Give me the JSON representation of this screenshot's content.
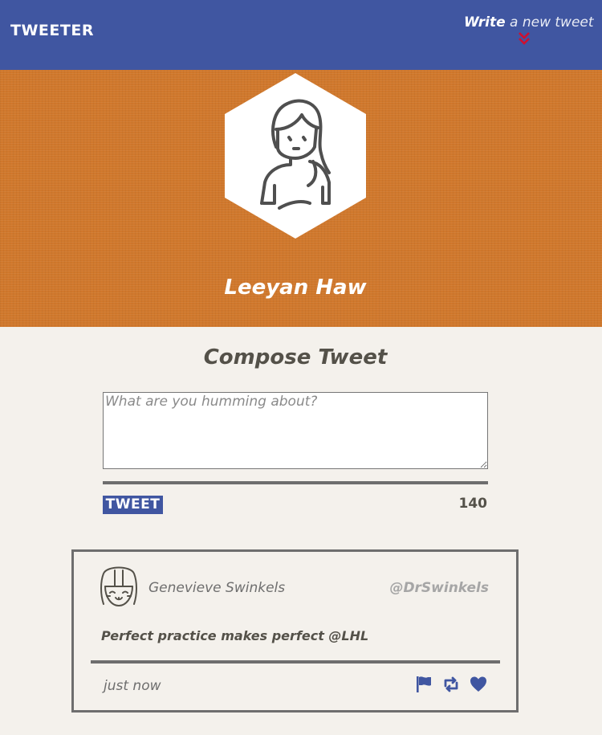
{
  "nav": {
    "brand": "TWEETER",
    "compose_toggle": {
      "strong": "Write",
      "rest": "a new tweet",
      "icon": "double-chevron-down-icon"
    }
  },
  "profile": {
    "name": "Leeyan Haw",
    "avatar_icon": "user-avatar-icon"
  },
  "compose": {
    "title": "Compose Tweet",
    "placeholder": "What are you humming about?",
    "value": "",
    "submit_label": "TWEET",
    "counter": "140"
  },
  "tweets": [
    {
      "author": "Genevieve Swinkels",
      "handle": "@DrSwinkels",
      "content": "Perfect practice makes perfect @LHL",
      "time": "just now",
      "avatar_icon": "user-avatar-icon",
      "actions": [
        "flag-icon",
        "retweet-icon",
        "heart-icon"
      ]
    }
  ],
  "colors": {
    "nav_bg": "#4056a1",
    "header_bg": "#d0782c",
    "page_bg": "#f4f1ec",
    "text": "#545149",
    "accent_red": "#d0102f"
  }
}
